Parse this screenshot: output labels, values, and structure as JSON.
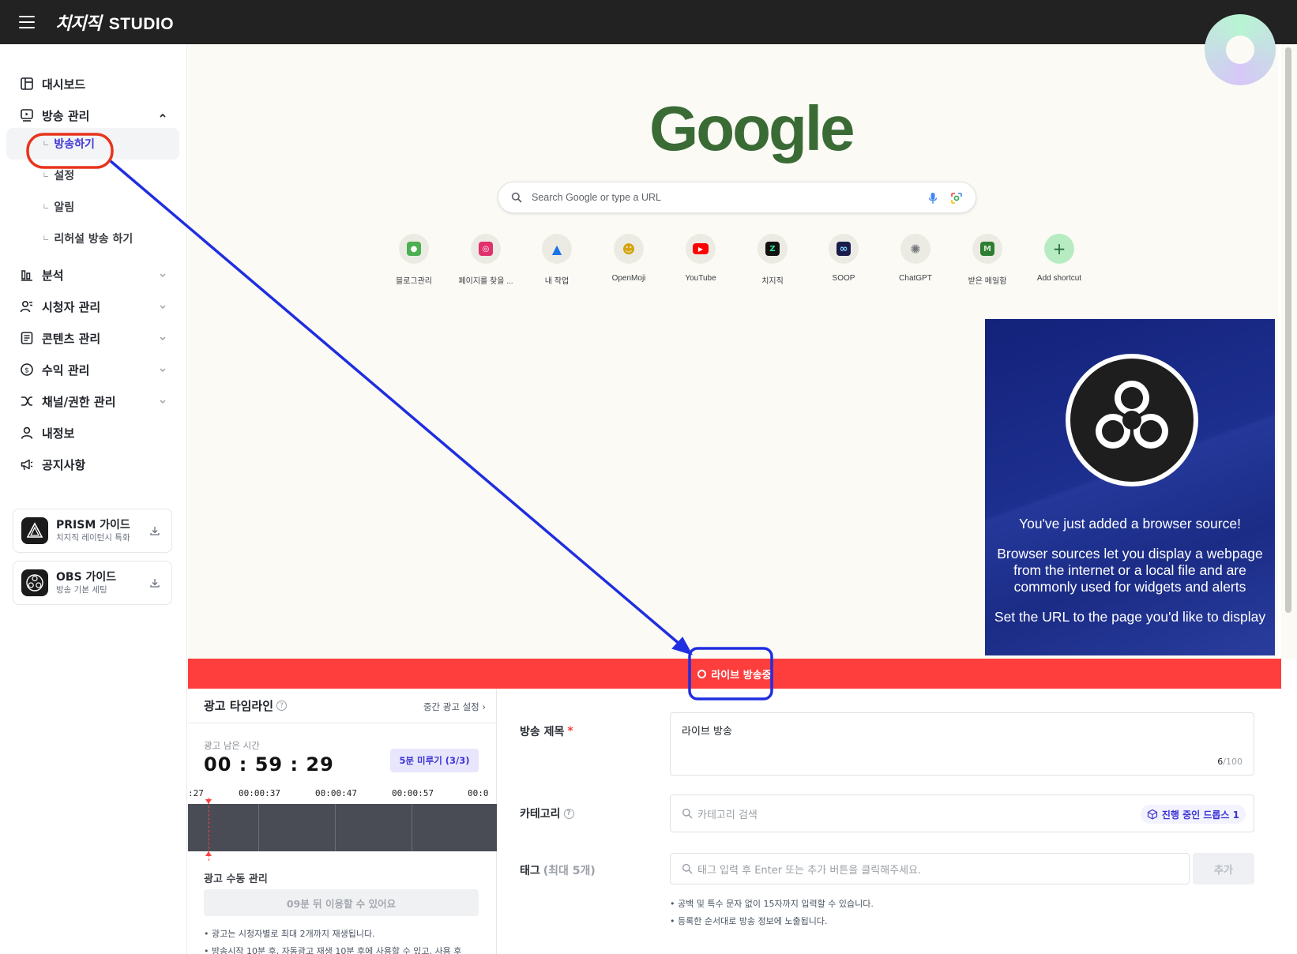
{
  "topbar": {
    "logo_mark": "치지직",
    "logo_studio": "STUDIO"
  },
  "sidebar": {
    "items": [
      {
        "label": "대시보드",
        "icon": "dashboard-icon"
      },
      {
        "label": "방송 관리",
        "icon": "broadcast-icon"
      },
      {
        "label": "분석",
        "icon": "analytics-icon"
      },
      {
        "label": "시청자 관리",
        "icon": "viewers-icon"
      },
      {
        "label": "콘텐츠 관리",
        "icon": "content-icon"
      },
      {
        "label": "수익 관리",
        "icon": "revenue-icon"
      },
      {
        "label": "채널/권한 관리",
        "icon": "channel-icon"
      },
      {
        "label": "내정보",
        "icon": "user-icon"
      },
      {
        "label": "공지사항",
        "icon": "megaphone-icon"
      }
    ],
    "sub_items": [
      {
        "label": "방송하기"
      },
      {
        "label": "설정"
      },
      {
        "label": "알림"
      },
      {
        "label": "리허설 방송 하기"
      }
    ],
    "guides": [
      {
        "title": "PRISM 가이드",
        "subtitle": "치지직 레이턴시 특화"
      },
      {
        "title": "OBS 가이드",
        "subtitle": "방송 기본 세팅"
      }
    ]
  },
  "preview": {
    "google_logo": "Google",
    "search_placeholder": "Search Google or type a URL",
    "shortcuts": [
      {
        "label": "블로그관리",
        "color": "#4caf50",
        "glyph": "●"
      },
      {
        "label": "페이지를 찾을 ...",
        "color": "#e1306c",
        "glyph": "◎"
      },
      {
        "label": "내 작업",
        "color": "#1a73e8",
        "glyph": "▲"
      },
      {
        "label": "OpenMoji",
        "color": "#f4c20d",
        "glyph": "☻"
      },
      {
        "label": "YouTube",
        "color": "#ff0000",
        "glyph": "▶"
      },
      {
        "label": "치지직",
        "color": "#111111",
        "glyph": "Z"
      },
      {
        "label": "SOOP",
        "color": "#1b1b4b",
        "glyph": "∞"
      },
      {
        "label": "ChatGPT",
        "color": "#9aa0a6",
        "glyph": "✺"
      },
      {
        "label": "받은 메일함",
        "color": "#2e7d32",
        "glyph": "M"
      },
      {
        "label": "Add shortcut",
        "color": "#b7ecc2",
        "glyph": "+"
      }
    ],
    "obs": {
      "line1": "You've just added a browser source!",
      "line2": "Browser sources let you display a webpage",
      "line3": "from the internet or a local file and are",
      "line4": "commonly used for widgets and alerts",
      "line5": "Set the URL to the page you'd like to display"
    }
  },
  "live": {
    "label": "라이브 방송중"
  },
  "ad_panel": {
    "title": "광고 타임라인",
    "setting": "중간 광고 설정",
    "remain_label": "광고 남은 시간",
    "timer": "00 : 59 : 29",
    "postpone": "5분 미루기 (3/3)",
    "timeline_labels": [
      ":27",
      "00:00:37",
      "00:00:47",
      "00:00:57",
      "00:0"
    ],
    "manual_title": "광고 수동 관리",
    "manual_button": "09분 뒤 이용할 수 있어요",
    "notes": [
      "• 광고는 시청자별로 최대 2개까지 재생됩니다.",
      "• 방송시작 10분 후, 자동광고 재생 10분 후에 사용할 수 있고, 사용 후"
    ]
  },
  "form": {
    "title_label": "방송 제목",
    "title_required": "*",
    "title_value": "라이브 방송",
    "title_count": "6",
    "title_max": "/100",
    "category_label": "카테고리",
    "category_placeholder": "카테고리 검색",
    "drops_badge": "진행 중인 드롭스 1",
    "tag_label": "태그",
    "tag_limit": "(최대 5개)",
    "tag_placeholder": "태그 입력 후 Enter 또는 추가 버튼을 클릭해주세요.",
    "tag_add": "추가",
    "tag_notes": [
      "• 공백 및 특수 문자 없이 15자까지 입력할 수 있습니다.",
      "• 등록한 순서대로 방송 정보에 노출됩니다."
    ]
  },
  "colors": {
    "live_red": "#fe3d3d",
    "accent": "#3d35d4",
    "annotation_red": "#e8341c",
    "annotation_blue": "#1f2ee0"
  }
}
